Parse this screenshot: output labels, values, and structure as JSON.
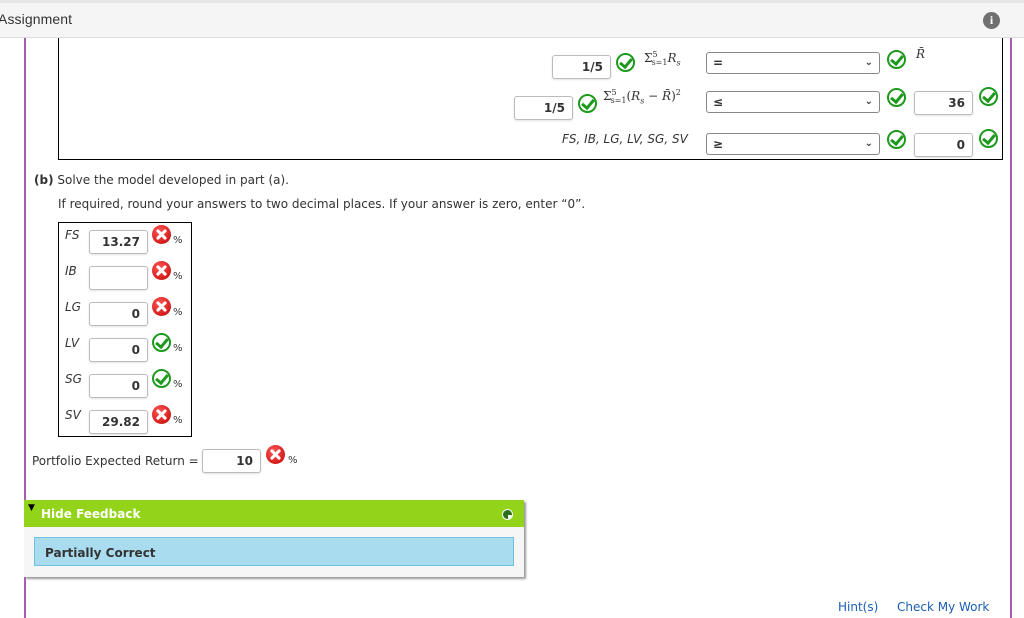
{
  "header": {
    "title": "Assignment",
    "info_icon": "info-icon"
  },
  "model": {
    "rows": [
      {
        "coefficient": "1/5",
        "coefficient_status": "correct",
        "expression": "Σ_{s=1}^{5} R_s",
        "operator": "=",
        "operator_status": "correct",
        "rhs_text": "R̄"
      },
      {
        "coefficient": "1/5",
        "coefficient_status": "correct",
        "expression": "Σ_{s=1}^{5} (R_s − R̄)²",
        "operator": "≤",
        "operator_status": "correct",
        "rhs_value": "36",
        "rhs_status": "correct"
      },
      {
        "label": "FS, IB, LG, LV, SG, SV",
        "operator": "≥",
        "operator_status": "correct",
        "rhs_value": "0",
        "rhs_status": "correct"
      }
    ]
  },
  "part_b": {
    "label": "(b)",
    "text": "Solve the model developed in part (a).",
    "instructions": "If required, round your answers to two decimal places. If your answer is zero, enter “0”."
  },
  "variables": [
    {
      "name": "FS",
      "value": "13.27",
      "status": "incorrect",
      "unit": "%"
    },
    {
      "name": "IB",
      "value": "",
      "status": "incorrect",
      "unit": "%"
    },
    {
      "name": "LG",
      "value": "0",
      "status": "incorrect",
      "unit": "%"
    },
    {
      "name": "LV",
      "value": "0",
      "status": "correct",
      "unit": "%"
    },
    {
      "name": "SG",
      "value": "0",
      "status": "correct",
      "unit": "%"
    },
    {
      "name": "SV",
      "value": "29.82",
      "status": "incorrect",
      "unit": "%"
    }
  ],
  "portfolio": {
    "label": "Portfolio Expected Return =",
    "value": "10",
    "status": "incorrect",
    "unit": "%"
  },
  "feedback": {
    "toggle_label": "Hide Feedback",
    "result": "Partially Correct",
    "colors": {
      "header": "#93d31a",
      "result_bg": "#a9dcef"
    }
  },
  "footer": {
    "hint_label": "Hint(s)",
    "check_label": "Check My Work"
  },
  "colors": {
    "correct": "#1d9a1d",
    "incorrect": "#d00000",
    "accent_border": "#a95bb4",
    "link": "#1a5fb4"
  }
}
